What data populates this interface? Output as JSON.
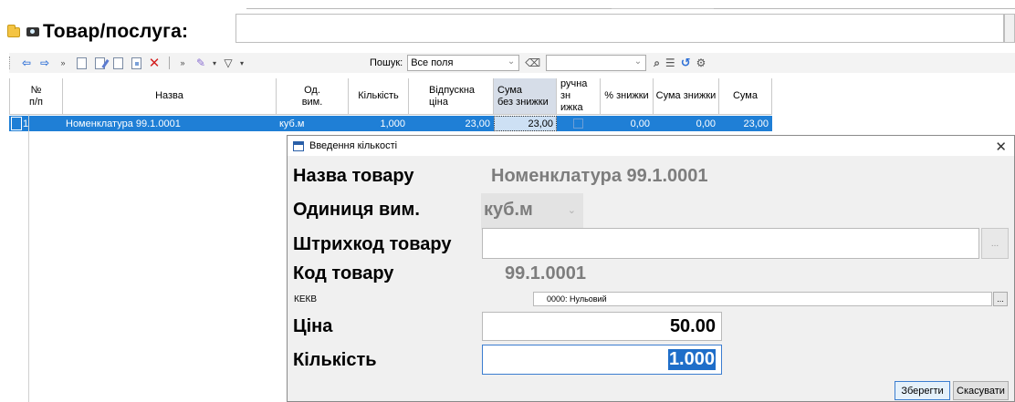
{
  "header": {
    "title": "Товар/послуга:",
    "input_value": ""
  },
  "toolbar": {
    "nav_icons": [
      "arrow-left-icon",
      "arrow-right-icon"
    ],
    "search_label": "Пошук:",
    "search_field": "Все поля",
    "search_value": ""
  },
  "grid": {
    "columns": [
      {
        "key": "num",
        "label": "№\nп/п"
      },
      {
        "key": "name",
        "label": "Назва"
      },
      {
        "key": "unit",
        "label": "Од.\nвим."
      },
      {
        "key": "qty",
        "label": "Кількість"
      },
      {
        "key": "price",
        "label": "Відпускна\nціна"
      },
      {
        "key": "sum_no_disc",
        "label": "Сума\nбез знижки"
      },
      {
        "key": "manual_disc",
        "label": "ручна зн\nижка"
      },
      {
        "key": "disc_pct",
        "label": "% знижки"
      },
      {
        "key": "disc_sum",
        "label": "Сума знижки"
      },
      {
        "key": "sum",
        "label": "Сума"
      }
    ],
    "rows": [
      {
        "num": "1",
        "name": "Номенклатура 99.1.0001",
        "unit": "куб.м",
        "qty": "1,000",
        "price": "23,00",
        "sum_no_disc": "23,00",
        "disc_pct": "0,00",
        "disc_sum": "0,00",
        "sum": "23,00"
      }
    ]
  },
  "dialog": {
    "title": "Введення кількості",
    "name_label": "Назва товару",
    "name_value": "Номенклатура 99.1.0001",
    "unit_label": "Одиниця вим.",
    "unit_value": "куб.м",
    "barcode_label": "Штрихкод товару",
    "barcode_value": "",
    "code_label": "Код товару",
    "code_value": "99.1.0001",
    "kekv_label": "КЕКВ",
    "kekv_value": "0000: Нульовий",
    "price_label": "Ціна",
    "price_value": "50.00",
    "qty_label": "Кількість",
    "qty_value": "1.000",
    "save_label": "Зберегти",
    "cancel_label": "Скасувати",
    "ellipsis": "..."
  }
}
